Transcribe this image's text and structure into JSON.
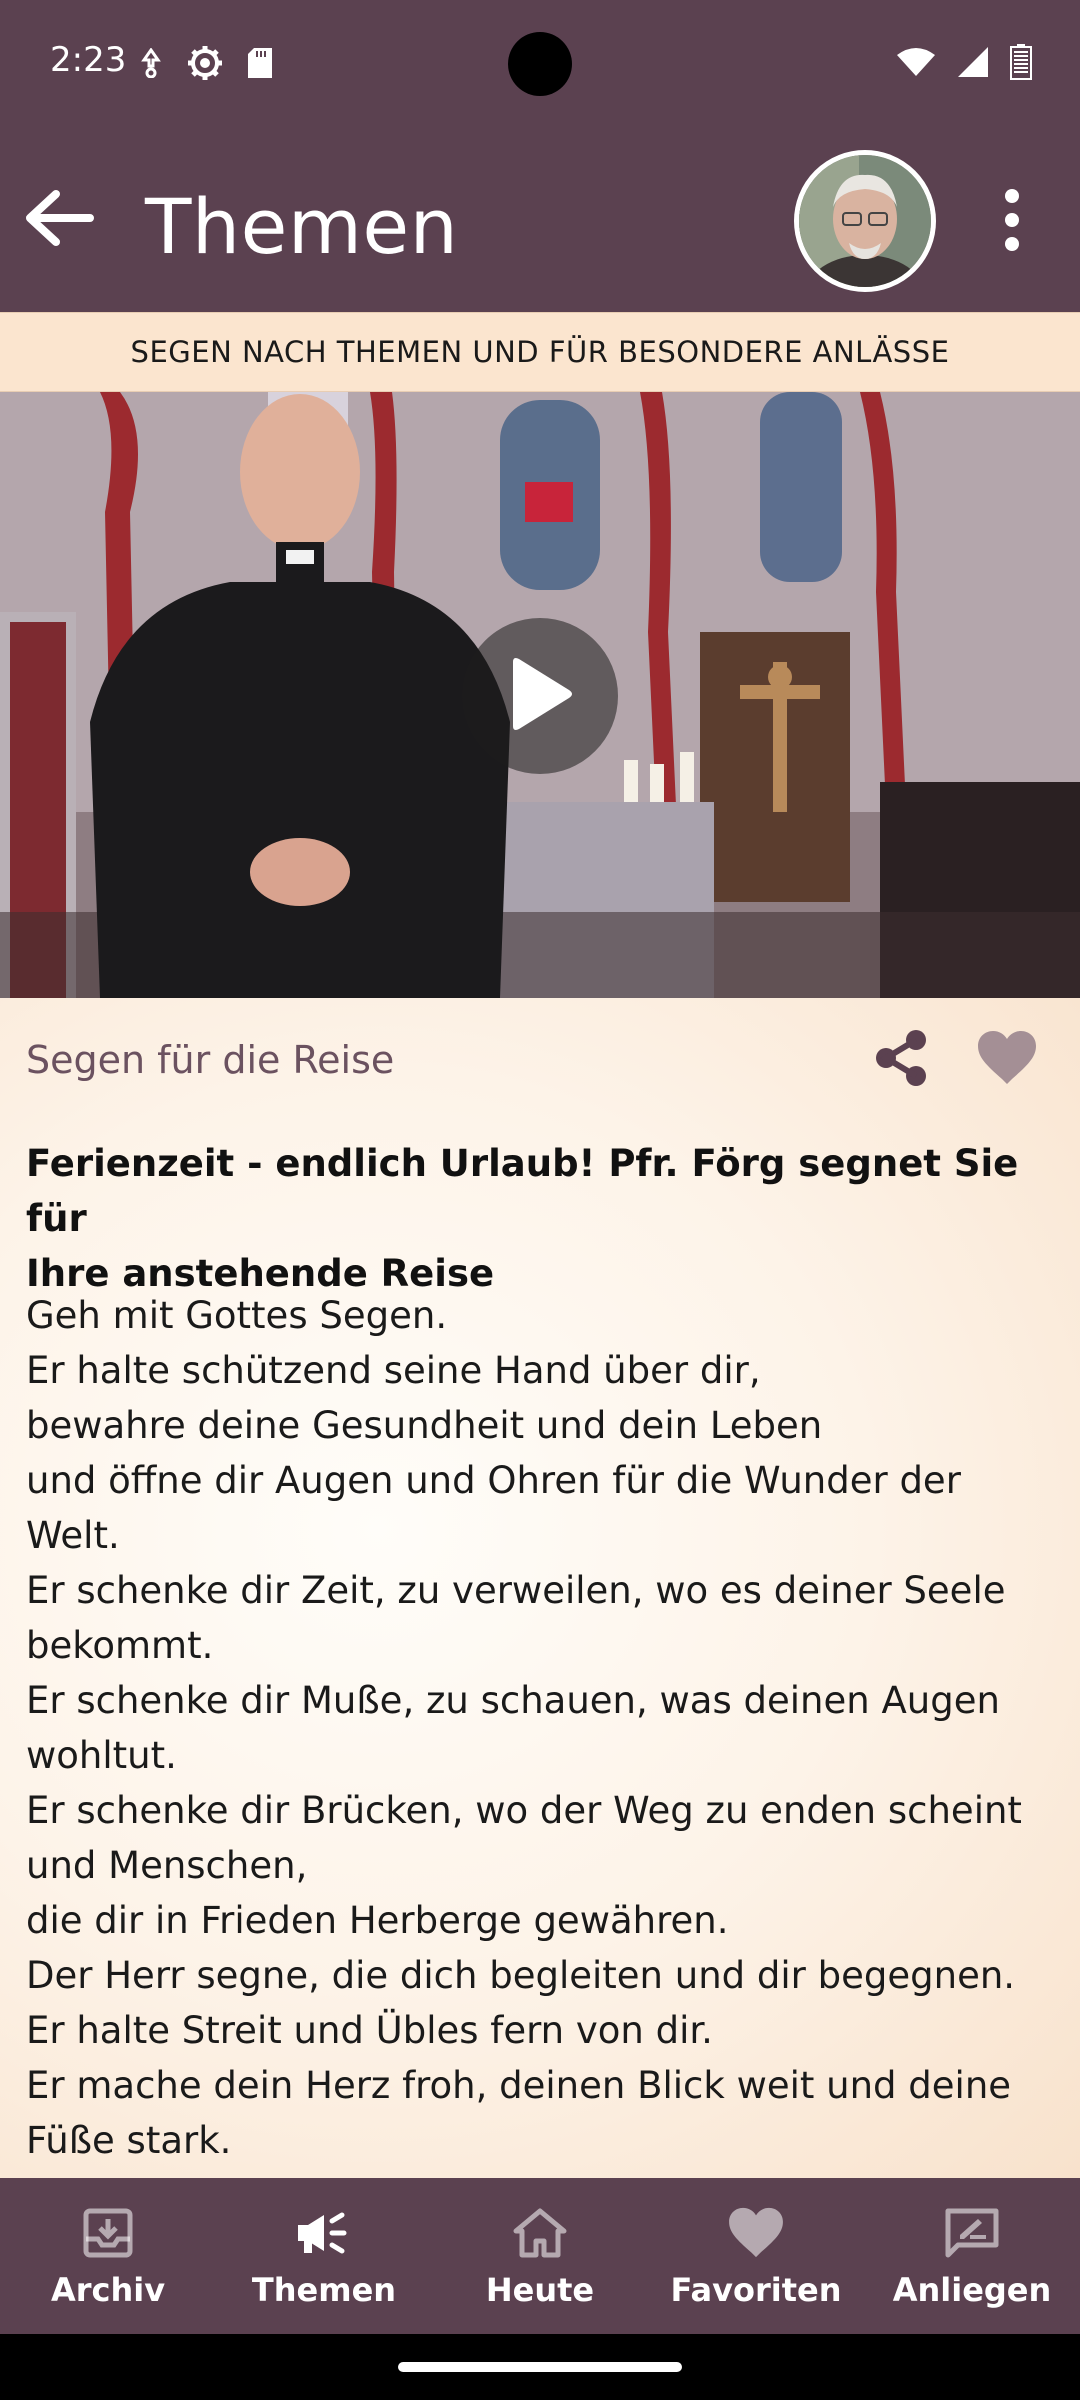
{
  "status_bar": {
    "time": "2:23",
    "icons_left": [
      "data-saver-icon",
      "settings-icon",
      "sd-card-icon"
    ],
    "icons_right": [
      "wifi-icon",
      "signal-icon",
      "battery-icon"
    ]
  },
  "app_bar": {
    "title": "Themen",
    "back_icon": "arrow-left-icon",
    "more_icon": "more-vert-icon"
  },
  "subheader": {
    "text": "SEGEN NACH THEMEN UND FÜR BESONDERE ANLÄSSE"
  },
  "video": {
    "play_icon": "play-icon"
  },
  "item": {
    "category": "Segen für die Reise",
    "headline_line1": "Ferienzeit - endlich Urlaub! Pfr. Förg segnet Sie für",
    "headline_line2": "Ihre anstehende Reise",
    "body_lines": [
      "Geh mit Gottes Segen.",
      "Er halte schützend seine Hand über dir,",
      "bewahre deine Gesundheit und dein Leben",
      "und öffne dir Augen und Ohren für die Wunder der",
      "Welt.",
      "Er schenke dir Zeit, zu verweilen, wo es deiner Seele",
      "bekommt.",
      "Er schenke dir Muße, zu schauen, was deinen Augen",
      "wohltut.",
      "Er schenke dir Brücken, wo der Weg zu enden scheint",
      "und Menschen,",
      "die dir in Frieden Herberge gewähren.",
      "Der Herr segne, die dich begleiten und dir begegnen.",
      "Er halte Streit und Übles fern von dir.",
      "Er mache dein Herz froh, deinen Blick weit und deine",
      "Füße stark."
    ]
  },
  "bottom_nav": {
    "items": [
      {
        "label": "Archiv",
        "icon": "archive-icon",
        "active": false
      },
      {
        "label": "Themen",
        "icon": "campaign-icon",
        "active": true
      },
      {
        "label": "Heute",
        "icon": "home-icon",
        "active": false
      },
      {
        "label": "Favoriten",
        "icon": "heart-icon",
        "active": false
      },
      {
        "label": "Anliegen",
        "icon": "feedback-icon",
        "active": false
      }
    ]
  },
  "colors": {
    "app_bar": "#5b4150",
    "subheader_bg": "#fbe5cf",
    "category_text": "#6b5260",
    "icon_brown": "#5b4150",
    "heart_muted": "#a48f95"
  }
}
